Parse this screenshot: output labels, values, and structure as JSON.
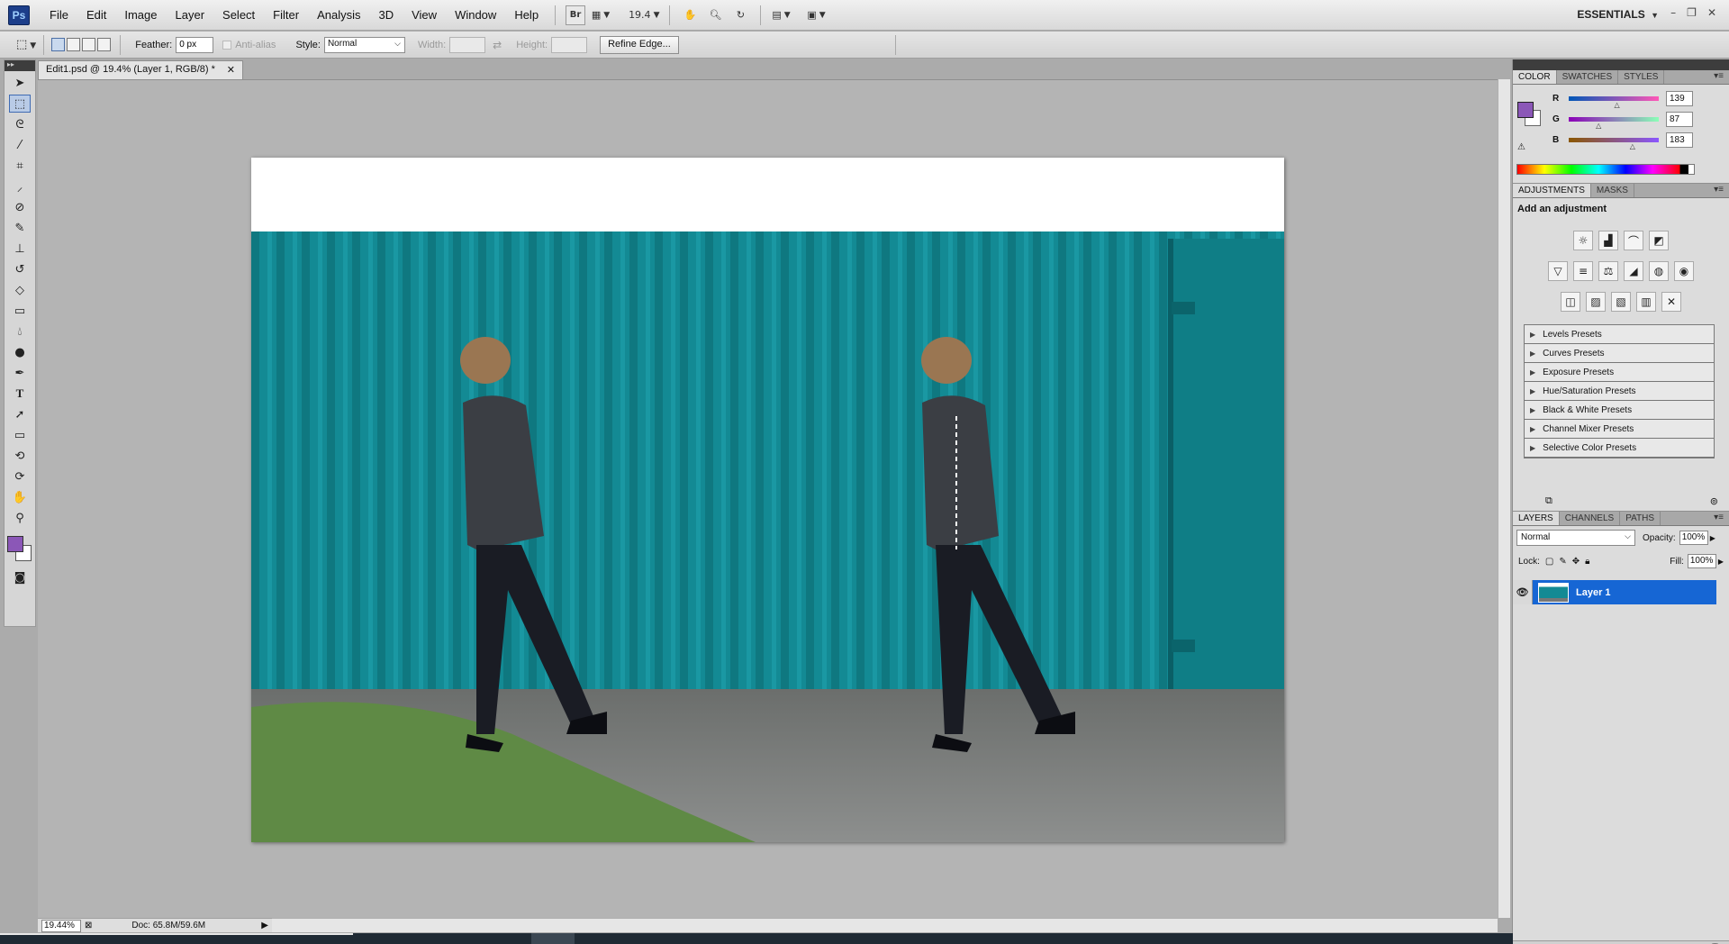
{
  "app": {
    "logo": "Ps",
    "workspace": "ESSENTIALS"
  },
  "menu": [
    "File",
    "Edit",
    "Image",
    "Layer",
    "Select",
    "Filter",
    "Analysis",
    "3D",
    "View",
    "Window",
    "Help"
  ],
  "appbar": {
    "bridge_label": "Br",
    "zoom": "19.4"
  },
  "options": {
    "feather_label": "Feather:",
    "feather_value": "0 px",
    "antialias_label": "Anti-alias",
    "style_label": "Style:",
    "style_value": "Normal",
    "width_label": "Width:",
    "height_label": "Height:",
    "refine_label": "Refine Edge..."
  },
  "document": {
    "tab_title": "Edit1.psd @ 19.4% (Layer 1, RGB/8) *",
    "zoom_status": "19.44%",
    "doc_size": "Doc: 65.8M/59.6M"
  },
  "colors": {
    "foreground": "#8b57b7",
    "background": "#ffffff",
    "container": "#138a94",
    "layer_selected": "#1666d4"
  },
  "color_panel": {
    "tabs": [
      "COLOR",
      "SWATCHES",
      "STYLES"
    ],
    "channels": [
      {
        "label": "R",
        "value": "139",
        "fraction": 0.545
      },
      {
        "label": "G",
        "value": "87",
        "fraction": 0.341
      },
      {
        "label": "B",
        "value": "183",
        "fraction": 0.718
      }
    ]
  },
  "adjustments_panel": {
    "tabs": [
      "ADJUSTMENTS",
      "MASKS"
    ],
    "title": "Add an adjustment",
    "presets": [
      "Levels Presets",
      "Curves Presets",
      "Exposure Presets",
      "Hue/Saturation Presets",
      "Black & White Presets",
      "Channel Mixer Presets",
      "Selective Color Presets"
    ]
  },
  "layers_panel": {
    "tabs": [
      "LAYERS",
      "CHANNELS",
      "PATHS"
    ],
    "blend_mode": "Normal",
    "opacity_label": "Opacity:",
    "opacity": "100%",
    "lock_label": "Lock:",
    "fill_label": "Fill:",
    "fill": "100%",
    "layers": [
      {
        "name": "Layer 1"
      }
    ]
  },
  "icons": {
    "tools": [
      "move-icon",
      "marquee-icon",
      "lasso-icon",
      "quick-select-icon",
      "crop-icon",
      "eyedropper-icon",
      "healing-brush-icon",
      "brush-icon",
      "clone-stamp-icon",
      "history-brush-icon",
      "eraser-icon",
      "gradient-icon",
      "blur-icon",
      "dodge-icon",
      "pen-icon",
      "type-icon",
      "path-select-icon",
      "shape-icon",
      "3d-rotate-icon",
      "3d-orbit-icon",
      "hand-icon",
      "zoom-icon"
    ]
  }
}
